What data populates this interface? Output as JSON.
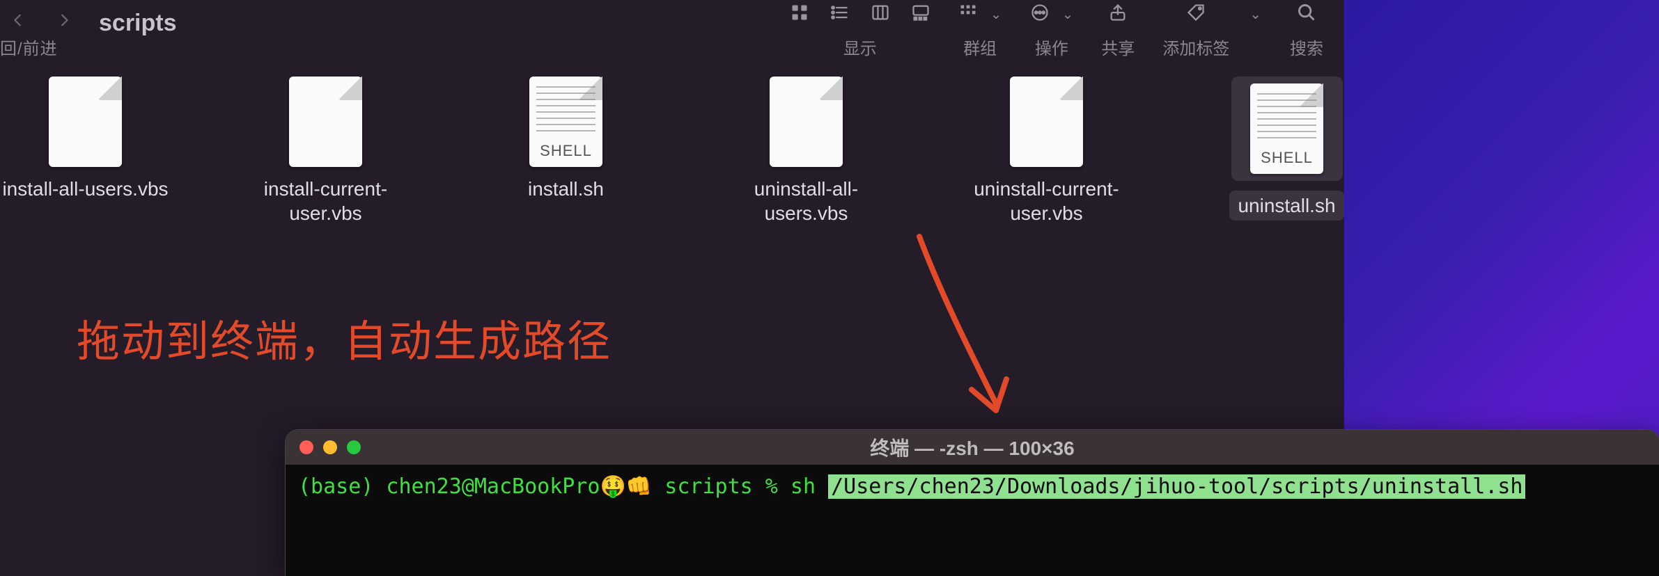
{
  "finder": {
    "title": "scripts",
    "nav_caption": "回/前进",
    "toolbar": {
      "view_caption": "显示",
      "group_caption": "群组",
      "action_caption": "操作",
      "share_caption": "共享",
      "tags_caption": "添加标签",
      "search_caption": "搜索"
    },
    "files": [
      {
        "name": "install-all-users.vbs",
        "type": "blank",
        "selected": false
      },
      {
        "name": "install-current-user.vbs",
        "type": "blank",
        "selected": false
      },
      {
        "name": "install.sh",
        "type": "shell",
        "badge": "SHELL",
        "selected": false
      },
      {
        "name": "uninstall-all-users.vbs",
        "type": "blank",
        "selected": false
      },
      {
        "name": "uninstall-current-user.vbs",
        "type": "blank",
        "selected": false
      },
      {
        "name": "uninstall.sh",
        "type": "shell",
        "badge": "SHELL",
        "selected": true
      }
    ]
  },
  "annotation": "拖动到终端，自动生成路径",
  "terminal": {
    "title": "终端 — -zsh — 100×36",
    "prompt_prefix": "(base) chen23@MacBookPro",
    "prompt_emoji": "🤑👊",
    "prompt_dir": "scripts",
    "prompt_symbol": "%",
    "command": "sh",
    "highlighted_path": "/Users/chen23/Downloads/jihuo-tool/scripts/uninstall.sh"
  }
}
